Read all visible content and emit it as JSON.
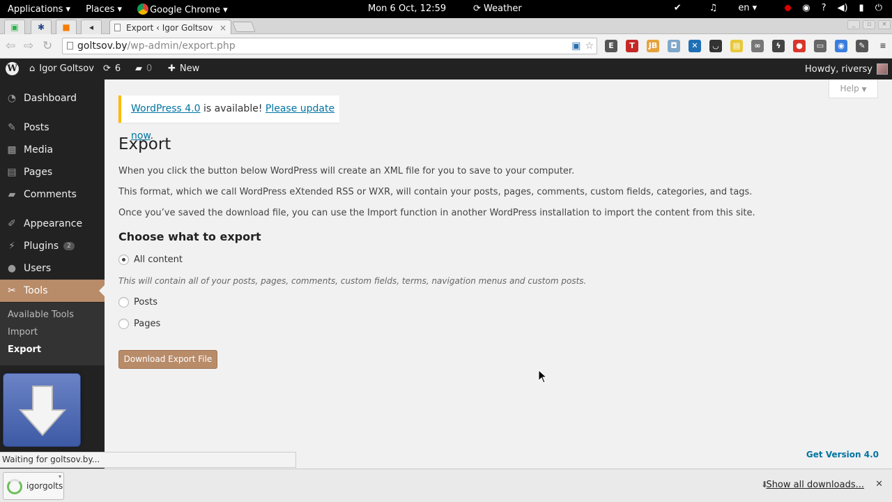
{
  "gnome_panel": {
    "applications": "Applications ▾",
    "places": "Places ▾",
    "app_name": "Google Chrome ▾",
    "clock": "Mon  6 Oct, 12:59",
    "weather": "Weather",
    "language": "en ▾"
  },
  "browser": {
    "tab_title": "Export ‹ Igor Goltsov",
    "url_host": "goltsov.by",
    "url_path": "/wp-admin/export.php",
    "status_text": "Waiting for goltsov.by..."
  },
  "adminbar": {
    "site_name": "Igor Goltsov",
    "updates_count": "6",
    "comments_count": "0",
    "new_label": "New",
    "howdy": "Howdy, riversy"
  },
  "sidebar": {
    "items": [
      {
        "label": "Dashboard"
      },
      {
        "label": "Posts"
      },
      {
        "label": "Media"
      },
      {
        "label": "Pages"
      },
      {
        "label": "Comments"
      },
      {
        "label": "Appearance"
      },
      {
        "label": "Plugins",
        "badge": "2"
      },
      {
        "label": "Users"
      },
      {
        "label": "Tools"
      }
    ],
    "submenu": [
      "Available Tools",
      "Import",
      "Export"
    ]
  },
  "main": {
    "help_label": "Help",
    "nag": {
      "link1": "WordPress 4.0",
      "middle": " is available! ",
      "link2": "Please update now",
      "end": "."
    },
    "title": "Export",
    "paragraphs": [
      "When you click the button below WordPress will create an XML file for you to save to your computer.",
      "This format, which we call WordPress eXtended RSS or WXR, will contain your posts, pages, comments, custom fields, categories, and tags.",
      "Once you’ve saved the download file, you can use the Import function in another WordPress installation to import the content from this site."
    ],
    "section_title": "Choose what to export",
    "options": [
      {
        "label": "All content",
        "checked": true
      },
      {
        "label": "Posts",
        "checked": false
      },
      {
        "label": "Pages",
        "checked": false
      }
    ],
    "all_content_desc": "This will contain all of your posts, pages, comments, custom fields, terms, navigation menus and custom posts.",
    "download_button": "Download Export File",
    "version_link": "Get Version 4.0"
  },
  "downloads_shelf": {
    "file_name": "igorgoltsov",
    "show_all": "Show all downloads..."
  },
  "colors": {
    "accent": "#b88b69",
    "link": "#0074a2",
    "nag_border": "#ffba00",
    "sidebar_bg": "#222222"
  }
}
